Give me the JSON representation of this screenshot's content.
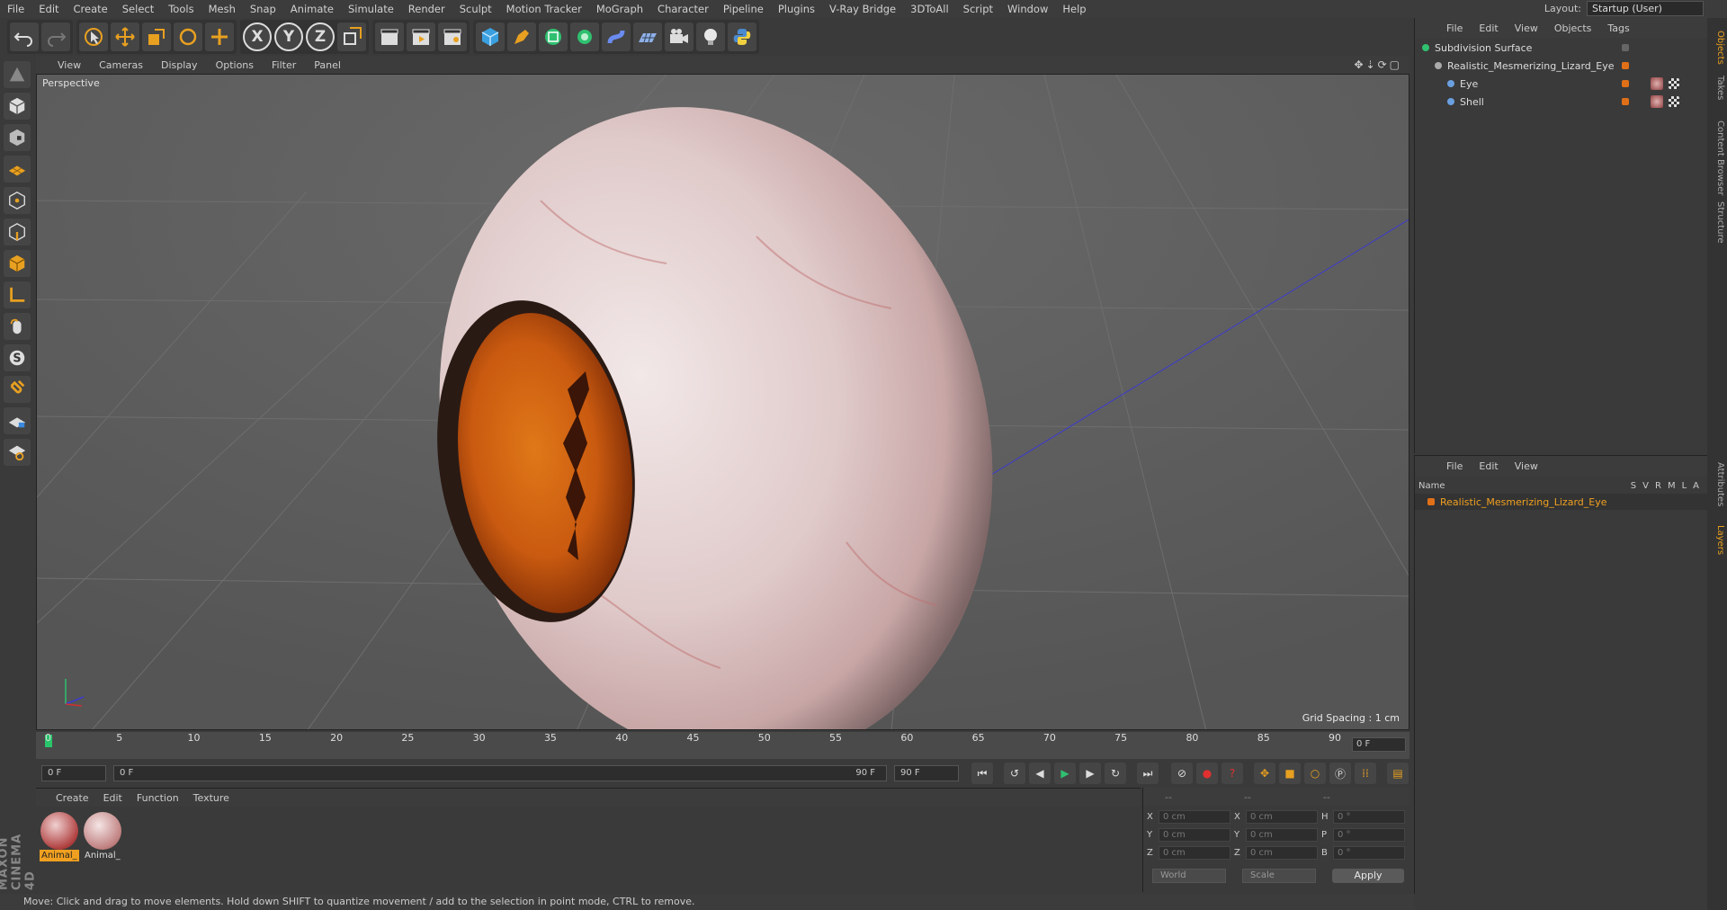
{
  "menu": [
    "File",
    "Edit",
    "Create",
    "Select",
    "Tools",
    "Mesh",
    "Snap",
    "Animate",
    "Simulate",
    "Render",
    "Sculpt",
    "Motion Tracker",
    "MoGraph",
    "Character",
    "Pipeline",
    "Plugins",
    "V-Ray Bridge",
    "3DToAll",
    "Script",
    "Window",
    "Help"
  ],
  "layout": {
    "label": "Layout:",
    "value": "Startup (User)"
  },
  "axis_buttons": [
    "X",
    "Y",
    "Z"
  ],
  "viewport": {
    "menu": [
      "View",
      "Cameras",
      "Display",
      "Options",
      "Filter",
      "Panel"
    ],
    "label": "Perspective",
    "grid_spacing": "Grid Spacing : 1 cm"
  },
  "timeline": {
    "ticks": [
      "0",
      "5",
      "10",
      "15",
      "20",
      "25",
      "30",
      "35",
      "40",
      "45",
      "50",
      "55",
      "60",
      "65",
      "70",
      "75",
      "80",
      "85",
      "90"
    ],
    "end_field": "0 F"
  },
  "transport": {
    "start": "0 F",
    "range_start": "0 F",
    "range_end": "90 F",
    "end": "90 F"
  },
  "materials": {
    "menu": [
      "Create",
      "Edit",
      "Function",
      "Texture"
    ],
    "items": [
      {
        "label": "Animal_"
      },
      {
        "label": "Animal_"
      }
    ]
  },
  "coords": {
    "headers": [
      "--",
      "--",
      "--"
    ],
    "rows": [
      {
        "a": "X",
        "av": "0 cm",
        "b": "X",
        "bv": "0 cm",
        "c": "H",
        "cv": "0 °"
      },
      {
        "a": "Y",
        "av": "0 cm",
        "b": "Y",
        "bv": "0 cm",
        "c": "P",
        "cv": "0 °"
      },
      {
        "a": "Z",
        "av": "0 cm",
        "b": "Z",
        "bv": "0 cm",
        "c": "B",
        "cv": "0 °"
      }
    ],
    "world": "World",
    "scale": "Scale",
    "apply": "Apply"
  },
  "status": "Move: Click and drag to move elements. Hold down SHIFT to quantize movement / add to the selection in point mode, CTRL to remove.",
  "objects": {
    "menu": [
      "File",
      "Edit",
      "View",
      "Objects",
      "Tags"
    ],
    "tree": [
      {
        "name": "Subdivision Surface",
        "indent": 0
      },
      {
        "name": "Realistic_Mesmerizing_Lizard_Eye",
        "indent": 1
      },
      {
        "name": "Eye",
        "indent": 2
      },
      {
        "name": "Shell",
        "indent": 2
      }
    ]
  },
  "layers": {
    "menu": [
      "File",
      "Edit",
      "View"
    ],
    "header": {
      "name": "Name",
      "cols": [
        "S",
        "V",
        "R",
        "M",
        "L",
        "A"
      ]
    },
    "items": [
      {
        "name": "Realistic_Mesmerizing_Lizard_Eye"
      }
    ]
  },
  "side_tabs": [
    "Objects",
    "Takes",
    "Content Browser",
    "Structure",
    "Attributes",
    "Layers"
  ],
  "brand": "MAXON CINEMA 4D",
  "colors": {
    "accent": "#e8a020",
    "selected_layer": "#f0a020",
    "timeline_cursor": "#29c56b"
  }
}
